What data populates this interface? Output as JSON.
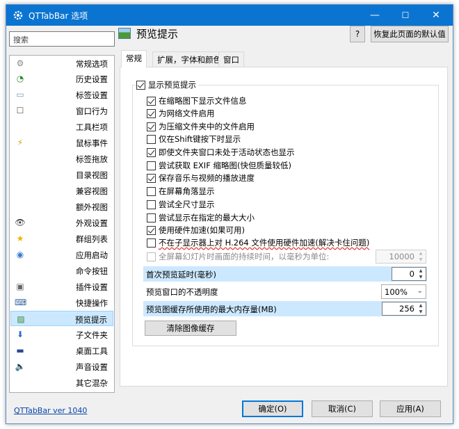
{
  "window": {
    "title": "QTTabBar 选项",
    "controls": {
      "minimize": "—",
      "maximize": "☐",
      "close": "✕"
    }
  },
  "sidebar": {
    "search_placeholder": "搜索",
    "items": [
      {
        "label": "常规选项",
        "icon": "gear-icon",
        "selected": false
      },
      {
        "label": "历史设置",
        "icon": "history-icon",
        "selected": false
      },
      {
        "label": "标签设置",
        "icon": "tab-icon",
        "selected": false
      },
      {
        "label": "窗口行为",
        "icon": "window-icon",
        "selected": false
      },
      {
        "label": "工具栏项",
        "icon": "",
        "selected": false
      },
      {
        "label": "鼠标事件",
        "icon": "lightning-icon",
        "selected": false
      },
      {
        "label": "标签拖放",
        "icon": "",
        "selected": false
      },
      {
        "label": "目录视图",
        "icon": "",
        "selected": false
      },
      {
        "label": "兼容视图",
        "icon": "",
        "selected": false
      },
      {
        "label": "额外视图",
        "icon": "",
        "selected": false
      },
      {
        "label": "外观设置",
        "icon": "eye-icon",
        "selected": false
      },
      {
        "label": "群组列表",
        "icon": "star-icon",
        "selected": false
      },
      {
        "label": "应用启动",
        "icon": "app-launch-icon",
        "selected": false
      },
      {
        "label": "命令按钮",
        "icon": "",
        "selected": false
      },
      {
        "label": "插件设置",
        "icon": "plugin-icon",
        "selected": false
      },
      {
        "label": "快捷操作",
        "icon": "keyboard-icon",
        "selected": false
      },
      {
        "label": "预览提示",
        "icon": "picture-icon",
        "selected": true
      },
      {
        "label": "子文件夹",
        "icon": "down-arrow-icon",
        "selected": false
      },
      {
        "label": "桌面工具",
        "icon": "desktop-icon",
        "selected": false
      },
      {
        "label": "声音设置",
        "icon": "speaker-icon",
        "selected": false
      },
      {
        "label": "其它混杂",
        "icon": "",
        "selected": false
      }
    ]
  },
  "header": {
    "title": "预览提示",
    "help_label": "?",
    "reset_label": "恢复此页面的默认值"
  },
  "tabs": [
    {
      "label": "常规",
      "active": true
    },
    {
      "label": "扩展，字体和颜色",
      "active": false
    },
    {
      "label": "窗口",
      "active": false
    }
  ],
  "group": {
    "label": "显示预览提示",
    "checked": true
  },
  "checkboxes": [
    {
      "label": "在缩略图下显示文件信息",
      "checked": true
    },
    {
      "label": "为网络文件启用",
      "checked": true
    },
    {
      "label": "为压缩文件夹中的文件启用",
      "checked": true
    },
    {
      "label": "仅在Shift键按下时显示",
      "checked": false
    },
    {
      "label": "即使文件夹窗口未处于活动状态也显示",
      "checked": true
    },
    {
      "label": "尝试获取 EXIF 缩略图(快但质量较低)",
      "checked": false
    },
    {
      "label": "保存音乐与视频的播放进度",
      "checked": true
    },
    {
      "label": "在屏幕角落显示",
      "checked": false
    },
    {
      "label": "尝试全尺寸显示",
      "checked": false
    },
    {
      "label": "尝试显示在指定的最大大小",
      "checked": false
    },
    {
      "label": "使用硬件加速(如果可用)",
      "checked": true
    },
    {
      "label": "不在子显示器上对 H.264 文件使用硬件加速(解决卡住问题)",
      "checked": false
    },
    {
      "label": "全屏幕幻灯片时画面的持续时间，以毫秒为单位:",
      "checked": false,
      "disabled": true
    }
  ],
  "settings": {
    "slideshow_ms": "10000",
    "first_delay_label": "首次预览延时(毫秒)",
    "first_delay_value": "0",
    "opacity_label": "预览窗口的不透明度",
    "opacity_value": "100%",
    "cache_label": "预览图缓存所使用的最大内存量(MB)",
    "cache_value": "256",
    "clear_cache_label": "清除图像缓存"
  },
  "footer": {
    "version": "QTTabBar ver 1040",
    "ok": "确定(O)",
    "cancel": "取消(C)",
    "apply": "应用(A)"
  },
  "colors": {
    "titlebar": "#0b74d1",
    "selection": "#cce8ff",
    "link": "#0645ad"
  }
}
